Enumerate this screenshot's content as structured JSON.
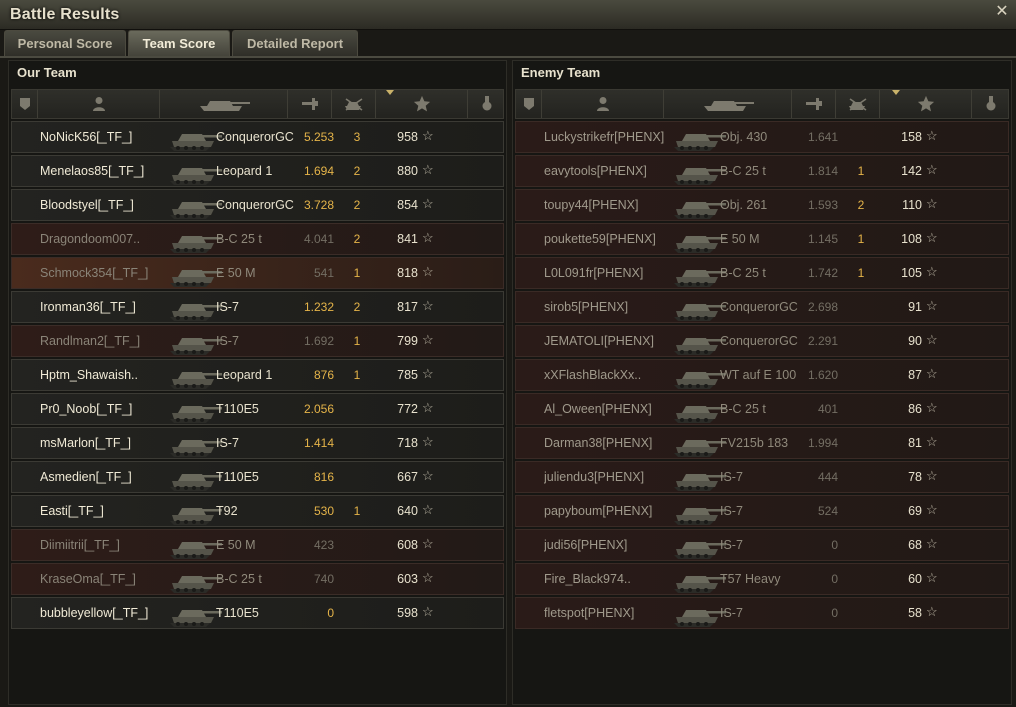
{
  "window": {
    "title": "Battle Results",
    "close_label": "✕"
  },
  "tabs": [
    {
      "label": "Personal Score",
      "active": false
    },
    {
      "label": "Team Score",
      "active": true
    },
    {
      "label": "Detailed Report",
      "active": false
    }
  ],
  "our_team": {
    "title": "Our Team",
    "rows": [
      {
        "player": "NoNicK56[_TF_]",
        "vehicle": "ConquerorGC",
        "damage": "5.253",
        "kills": "3",
        "xp": "958",
        "state": "alive"
      },
      {
        "player": "Menelaos85[_TF_]",
        "vehicle": "Leopard 1",
        "damage": "1.694",
        "kills": "2",
        "xp": "880",
        "state": "alive"
      },
      {
        "player": "Bloodstyel[_TF_]",
        "vehicle": "ConquerorGC",
        "damage": "3.728",
        "kills": "2",
        "xp": "854",
        "state": "alive"
      },
      {
        "player": "Dragondoom007..",
        "vehicle": "B-C 25 t",
        "damage": "4.041",
        "kills": "2",
        "xp": "841",
        "state": "dead"
      },
      {
        "player": "Schmock354[_TF_]",
        "vehicle": "E 50 M",
        "damage": "541",
        "kills": "1",
        "xp": "818",
        "state": "squad"
      },
      {
        "player": "Ironman36[_TF_]",
        "vehicle": "IS-7",
        "damage": "1.232",
        "kills": "2",
        "xp": "817",
        "state": "alive"
      },
      {
        "player": "Randlman2[_TF_]",
        "vehicle": "IS-7",
        "damage": "1.692",
        "kills": "1",
        "xp": "799",
        "state": "dead"
      },
      {
        "player": "Hptm_Shawaish..",
        "vehicle": "Leopard 1",
        "damage": "876",
        "kills": "1",
        "xp": "785",
        "state": "alive"
      },
      {
        "player": "Pr0_Noob[_TF_]",
        "vehicle": "T110E5",
        "damage": "2.056",
        "kills": "",
        "xp": "772",
        "state": "alive"
      },
      {
        "player": "msMarlon[_TF_]",
        "vehicle": "IS-7",
        "damage": "1.414",
        "kills": "",
        "xp": "718",
        "state": "alive"
      },
      {
        "player": "Asmedien[_TF_]",
        "vehicle": "T110E5",
        "damage": "816",
        "kills": "",
        "xp": "667",
        "state": "alive"
      },
      {
        "player": "Easti[_TF_]",
        "vehicle": "T92",
        "damage": "530",
        "kills": "1",
        "xp": "640",
        "state": "alive"
      },
      {
        "player": "Diimiitrii[_TF_]",
        "vehicle": "E 50 M",
        "damage": "423",
        "kills": "",
        "xp": "608",
        "state": "dead"
      },
      {
        "player": "KraseOma[_TF_]",
        "vehicle": "B-C 25 t",
        "damage": "740",
        "kills": "",
        "xp": "603",
        "state": "dead"
      },
      {
        "player": "bubbleyellow[_TF_]",
        "vehicle": "T110E5",
        "damage": "0",
        "kills": "",
        "xp": "598",
        "state": "alive"
      }
    ]
  },
  "enemy_team": {
    "title": "Enemy Team",
    "rows": [
      {
        "player": "Luckystrikefr[PHENX]",
        "vehicle": "Obj. 430",
        "damage": "1.641",
        "kills": "",
        "xp": "158"
      },
      {
        "player": "eavytools[PHENX]",
        "vehicle": "B-C 25 t",
        "damage": "1.814",
        "kills": "1",
        "xp": "142"
      },
      {
        "player": "toupy44[PHENX]",
        "vehicle": "Obj. 261",
        "damage": "1.593",
        "kills": "2",
        "xp": "110"
      },
      {
        "player": "poukette59[PHENX]",
        "vehicle": "E 50 M",
        "damage": "1.145",
        "kills": "1",
        "xp": "108"
      },
      {
        "player": "L0L091fr[PHENX]",
        "vehicle": "B-C 25 t",
        "damage": "1.742",
        "kills": "1",
        "xp": "105"
      },
      {
        "player": "sirob5[PHENX]",
        "vehicle": "ConquerorGC",
        "damage": "2.698",
        "kills": "",
        "xp": "91"
      },
      {
        "player": "JEMATOLI[PHENX]",
        "vehicle": "ConquerorGC",
        "damage": "2.291",
        "kills": "",
        "xp": "90"
      },
      {
        "player": "xXFlashBlackXx..",
        "vehicle": "WT auf E 100",
        "damage": "1.620",
        "kills": "",
        "xp": "87"
      },
      {
        "player": "Al_Oween[PHENX]",
        "vehicle": "B-C 25 t",
        "damage": "401",
        "kills": "",
        "xp": "86"
      },
      {
        "player": "Darman38[PHENX]",
        "vehicle": "FV215b 183",
        "damage": "1.994",
        "kills": "",
        "xp": "81"
      },
      {
        "player": "juliendu3[PHENX]",
        "vehicle": "IS-7",
        "damage": "444",
        "kills": "",
        "xp": "78"
      },
      {
        "player": "papyboum[PHENX]",
        "vehicle": "IS-7",
        "damage": "524",
        "kills": "",
        "xp": "69"
      },
      {
        "player": "judi56[PHENX]",
        "vehicle": "IS-7",
        "damage": "0",
        "kills": "",
        "xp": "68"
      },
      {
        "player": "Fire_Black974..",
        "vehicle": "T57 Heavy",
        "damage": "0",
        "kills": "",
        "xp": "60"
      },
      {
        "player": "fletspot[PHENX]",
        "vehicle": "IS-7",
        "damage": "0",
        "kills": "",
        "xp": "58"
      }
    ]
  },
  "columns": {
    "icons": [
      "squad-icon",
      "player-icon",
      "tank-icon",
      "damage-icon",
      "kills-icon",
      "xp-star-icon",
      "medal-icon"
    ],
    "star_glyph": "☆"
  }
}
